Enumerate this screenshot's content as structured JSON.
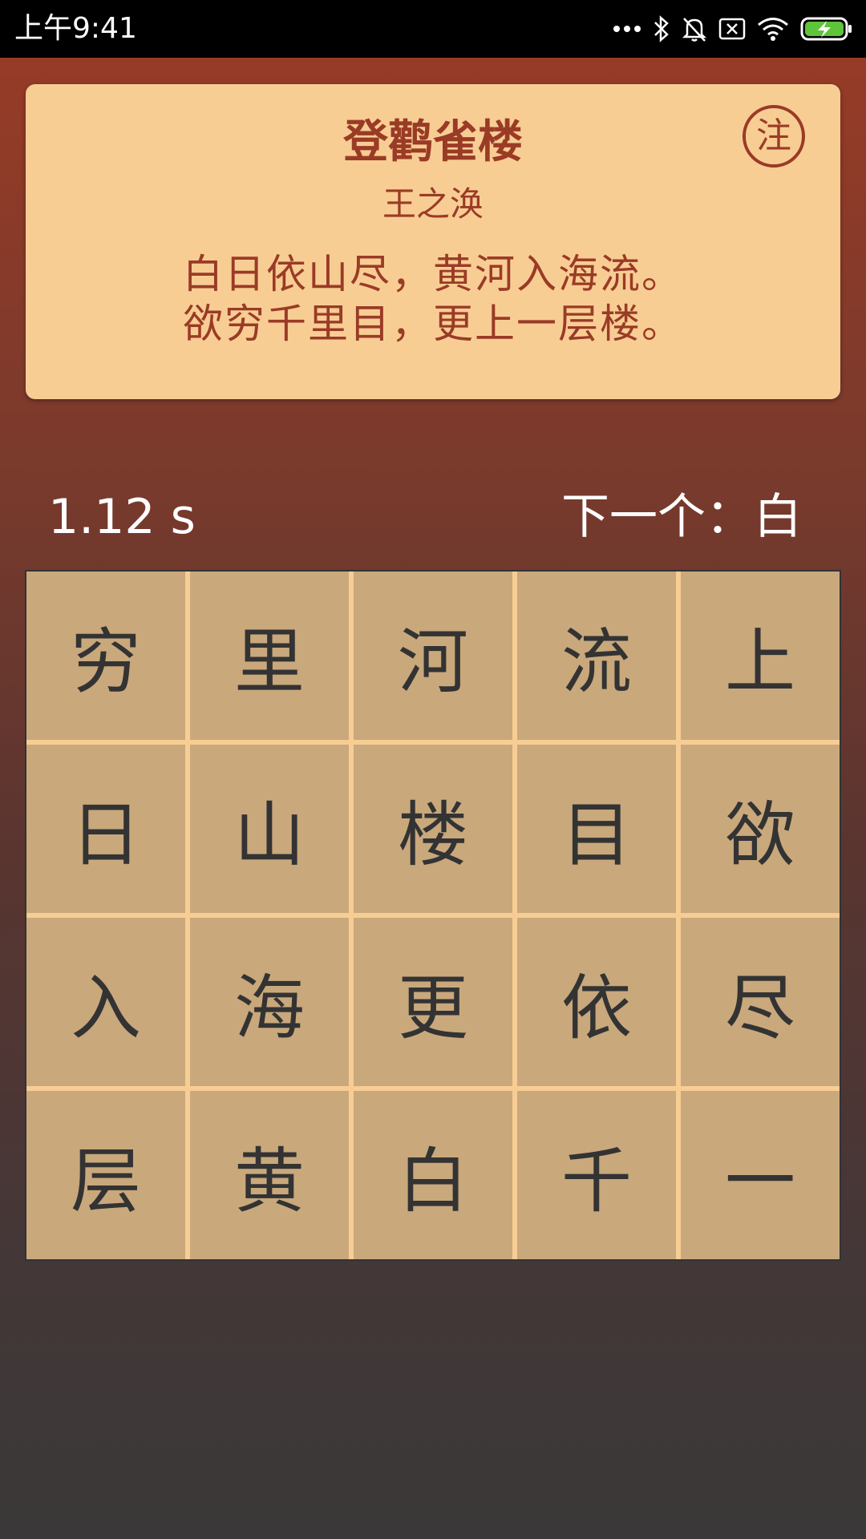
{
  "status_bar": {
    "time": "上午9:41",
    "icons": [
      "more-dots-icon",
      "bluetooth-icon",
      "bell-off-icon",
      "sim-off-icon",
      "wifi-icon",
      "battery-charging-icon"
    ]
  },
  "poem": {
    "title": "登鹳雀楼",
    "author": "王之涣",
    "lines": [
      "白日依山尽，黄河入海流。",
      "欲穷千里目，更上一层楼。"
    ],
    "note_label": "注"
  },
  "game": {
    "timer": "1.12 s",
    "next_label": "下一个：白"
  },
  "grid": {
    "cells": [
      "穷",
      "里",
      "河",
      "流",
      "上",
      "日",
      "山",
      "楼",
      "目",
      "欲",
      "入",
      "海",
      "更",
      "依",
      "尽",
      "层",
      "黄",
      "白",
      "千",
      "一"
    ]
  },
  "colors": {
    "accent": "#9a3b26",
    "card_bg": "#f8cd94",
    "cell_bg": "#c9a87c",
    "cell_text": "#333333"
  }
}
